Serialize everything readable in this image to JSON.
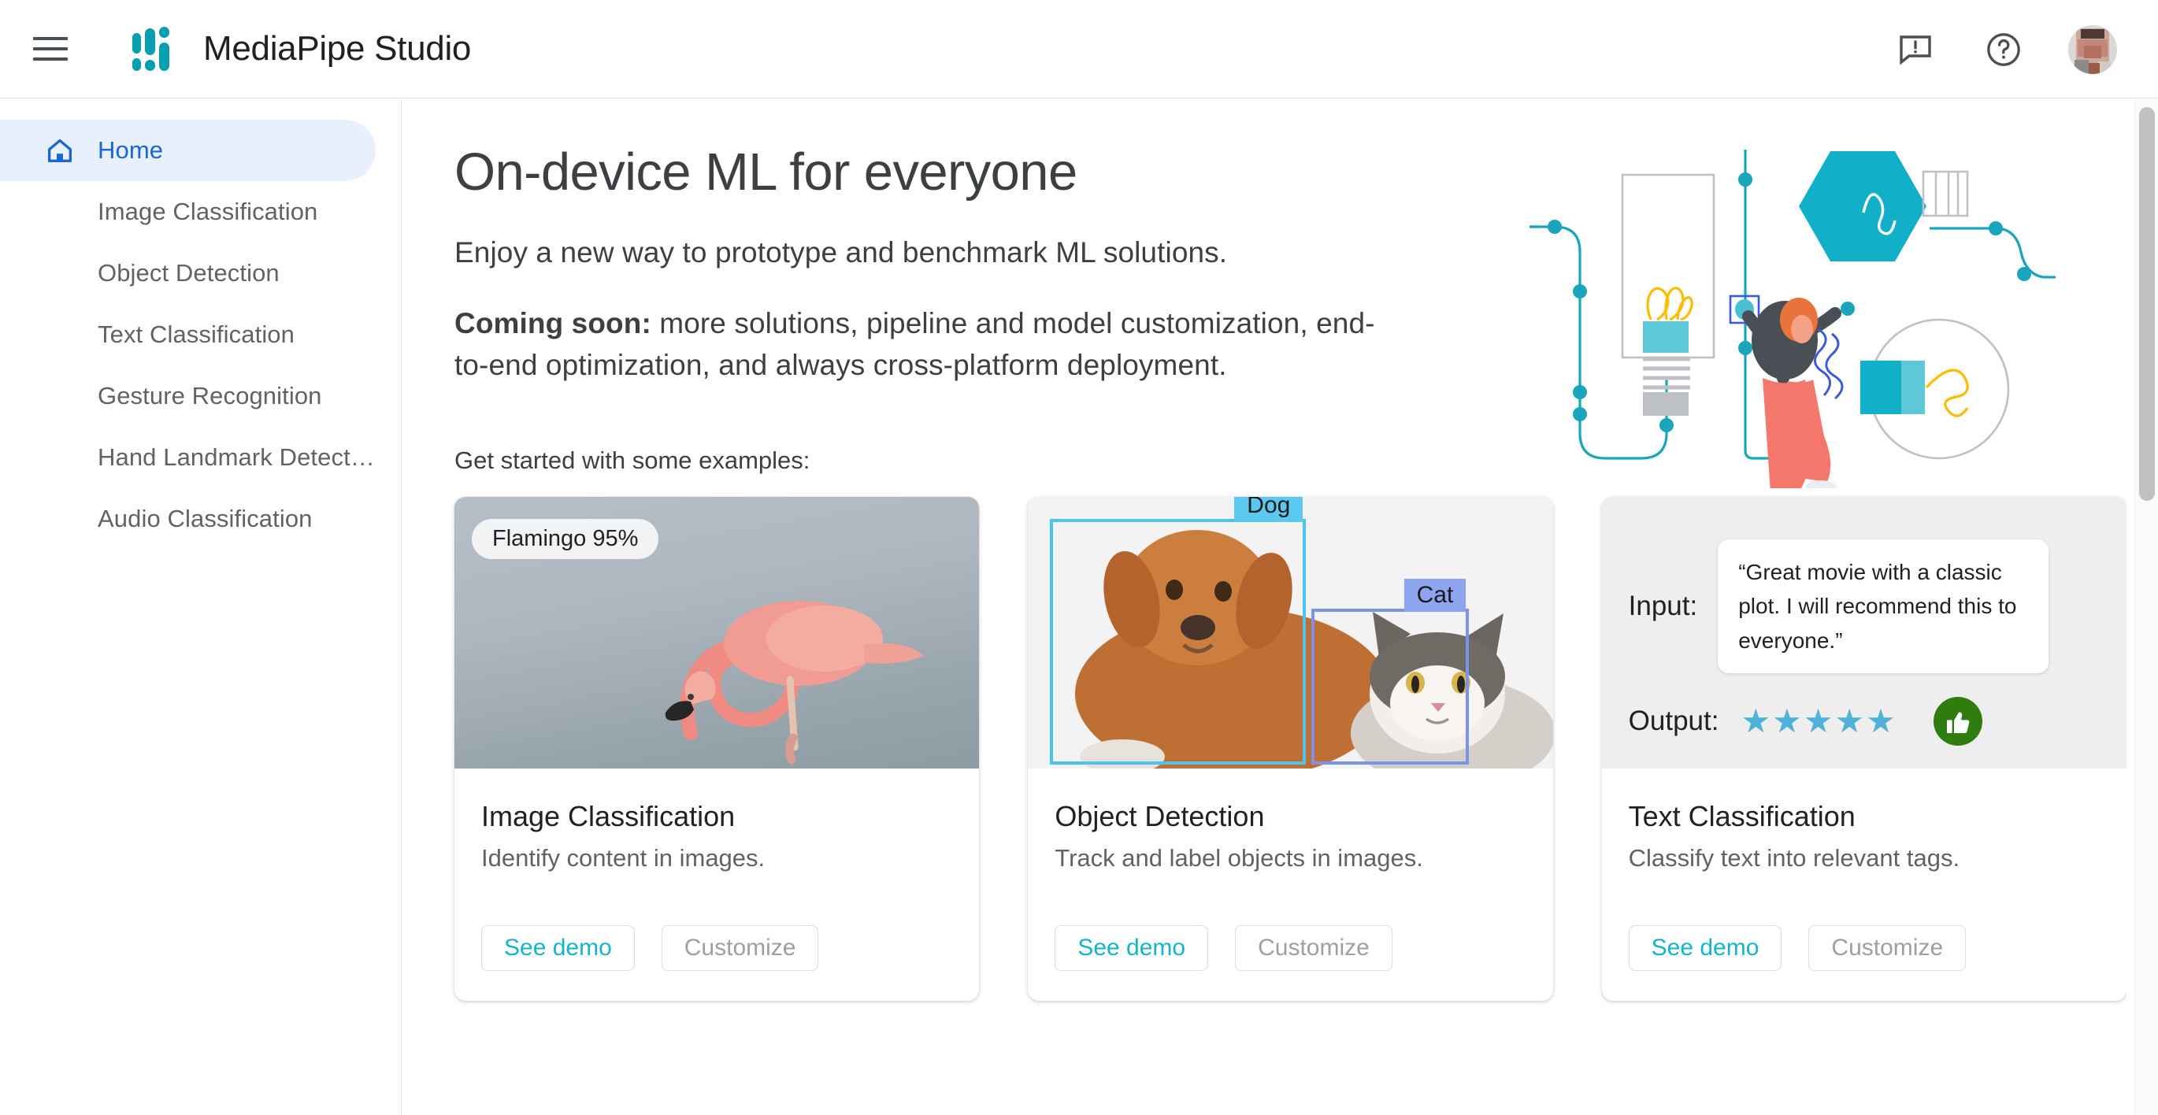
{
  "header": {
    "menu_icon": "hamburger-menu-icon",
    "logo_icon": "mediapipe-logo-icon",
    "app_title": "MediaPipe Studio",
    "feedback_icon": "feedback-icon",
    "help_icon": "help-circle-icon",
    "avatar_icon": "user-avatar"
  },
  "sidebar": {
    "items": [
      {
        "label": "Home",
        "icon": "home-icon",
        "active": true
      },
      {
        "label": "Image Classification",
        "icon": "",
        "active": false
      },
      {
        "label": "Object Detection",
        "icon": "",
        "active": false
      },
      {
        "label": "Text Classification",
        "icon": "",
        "active": false
      },
      {
        "label": "Gesture Recognition",
        "icon": "",
        "active": false
      },
      {
        "label": "Hand Landmark Detect…",
        "icon": "",
        "active": false
      },
      {
        "label": "Audio Classification",
        "icon": "",
        "active": false
      }
    ]
  },
  "hero": {
    "title": "On-device ML for everyone",
    "subtitle": "Enjoy a new way to prototype and benchmark ML solutions.",
    "coming_soon_label": "Coming soon:",
    "coming_soon_body": " more solutions, pipeline and model customization, end-to-end optimization, and always cross-platform deployment.",
    "illustration_icon": "ml-pipeline-illustration"
  },
  "examples": {
    "label": "Get started with some examples:",
    "cards": [
      {
        "title": "Image Classification",
        "description": "Identify content in images.",
        "demo_label": "See demo",
        "customize_label": "Customize",
        "media_icon": "flamingo-photo",
        "badge": "Flamingo 95%"
      },
      {
        "title": "Object Detection",
        "description": "Track and label objects in images.",
        "demo_label": "See demo",
        "customize_label": "Customize",
        "media_icon": "dog-cat-photo",
        "box_labels": [
          "Dog",
          "Cat"
        ]
      },
      {
        "title": "Text Classification",
        "description": "Classify text into relevant tags.",
        "demo_label": "See demo",
        "customize_label": "Customize",
        "media_icon": "text-sentiment-graphic",
        "input_label": "Input:",
        "input_text": "“Great movie with a classic plot. I will recommend this to everyone.”",
        "output_label": "Output:",
        "stars": "★★★★★",
        "thumb_icon": "thumbs-up-icon"
      }
    ]
  },
  "colors": {
    "brand_teal": "#079fb0",
    "accent_cyan": "#12b5cb",
    "active_blue": "#1967d2",
    "active_blue_bg": "#e8f0fe",
    "text_primary": "#3c4043",
    "text_secondary": "#5f6368",
    "star_teal": "#4fb3d9",
    "thumb_green": "#2e7d0e",
    "dog_box": "#5bc8f0",
    "cat_box": "#8fa4ee"
  },
  "scrollbar": {
    "name": "vertical-scrollbar"
  }
}
